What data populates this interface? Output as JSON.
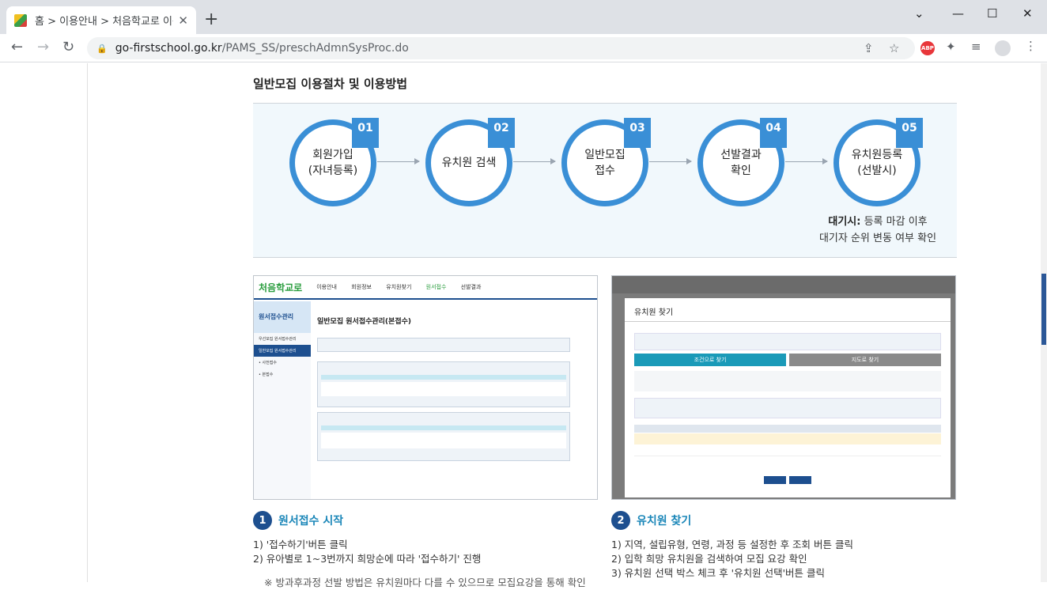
{
  "browser": {
    "tab_title": "홈 > 이용안내 > 처음학교로 이용",
    "url_host": "go-firstschool.go.kr",
    "url_path": "/PAMS_SS/preschAdmnSysProc.do",
    "abp_label": "ABP"
  },
  "page": {
    "title": "일반모집 이용절차 및 이용방법",
    "steps": [
      {
        "num": "01",
        "label": "회원가입\n(자녀등록)"
      },
      {
        "num": "02",
        "label": "유치원 검색"
      },
      {
        "num": "03",
        "label": "일반모집\n접수"
      },
      {
        "num": "04",
        "label": "선발결과\n확인"
      },
      {
        "num": "05",
        "label": "유치원등록\n(선발시)"
      }
    ],
    "wait_bold": "대기시:",
    "wait_text1": " 등록 마감 이후",
    "wait_text2": "대기자 순위 변동 여부 확인",
    "shot1": {
      "logo": "처음학교로",
      "menu": [
        "이용안내",
        "회원정보",
        "유치원찾기",
        "원서접수",
        "선발결과"
      ],
      "side_title": "원서접수관리",
      "side_items": [
        "우선모집 원서접수관리",
        "일반모집 원서접수관리",
        "• 사전접수",
        "• 본접수"
      ],
      "heading": "일반모집 원서접수관리(본접수)"
    },
    "shot2": {
      "modal_title": "유치원 찾기",
      "tab1": "조건으로 찾기",
      "tab2": "지도로 찾기"
    },
    "section1": {
      "num": "1",
      "title": "원서접수 시작",
      "lines": [
        "1) '접수하기'버튼 클릭",
        "2) 유아별로 1~3번까지 희망순에 따라 '접수하기' 진행",
        "※ 방과후과정 선발 방법은 유치원마다 다를 수 있으므로 모집요강을 통해 확인 필요"
      ]
    },
    "section2": {
      "num": "2",
      "title": "유치원 찾기",
      "lines": [
        "1) 지역, 설립유형, 연령, 과정 등 설정한 후 조회 버튼 클릭",
        "2) 입학 희망 유치원을 검색하여 모집 요강 확인",
        "3) 유치원 선택 박스 체크 후 '유치원 선택'버튼 클릭"
      ]
    }
  }
}
